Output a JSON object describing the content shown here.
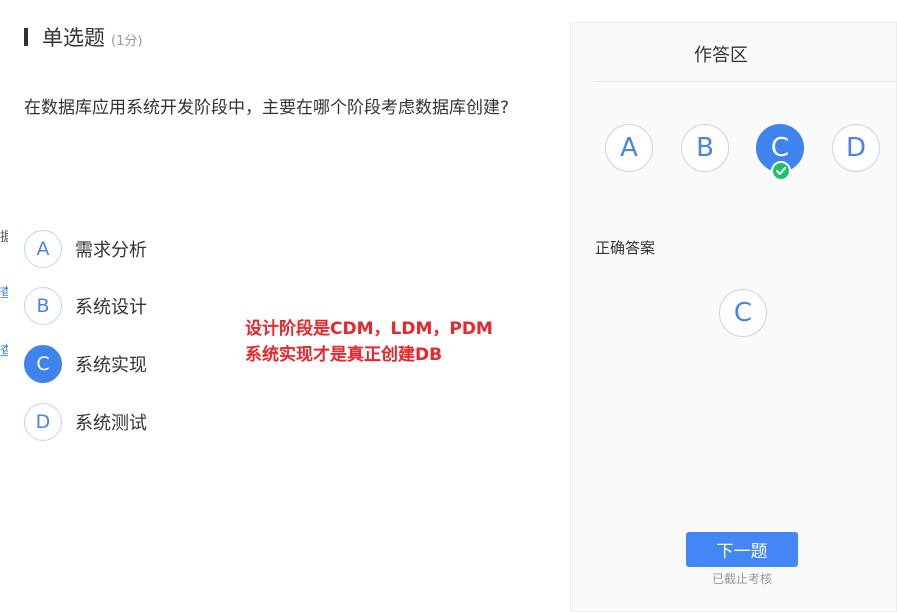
{
  "left_fragments": [
    "据",
    "查",
    "查"
  ],
  "question": {
    "type": "单选题",
    "score": "(1分)",
    "stem": "在数据库应用系统开发阶段中，主要在哪个阶段考虑数据库创建?",
    "options": [
      {
        "letter": "A",
        "text": "需求分析"
      },
      {
        "letter": "B",
        "text": "系统设计"
      },
      {
        "letter": "C",
        "text": "系统实现"
      },
      {
        "letter": "D",
        "text": "系统测试"
      }
    ],
    "selected": "C"
  },
  "annotation": {
    "line1": "设计阶段是CDM，LDM，PDM",
    "line2": "系统实现才是真正创建DB",
    "color": "#e8262b"
  },
  "answer_panel": {
    "title": "作答区",
    "options": [
      "A",
      "B",
      "C",
      "D"
    ],
    "correct_label": "正确答案",
    "correct_answer": "C",
    "next_button": "下一题",
    "status": "已截止考核"
  },
  "colors": {
    "accent": "#3f84ee",
    "check": "#1fbf6a"
  },
  "icons": [
    "check-icon"
  ]
}
